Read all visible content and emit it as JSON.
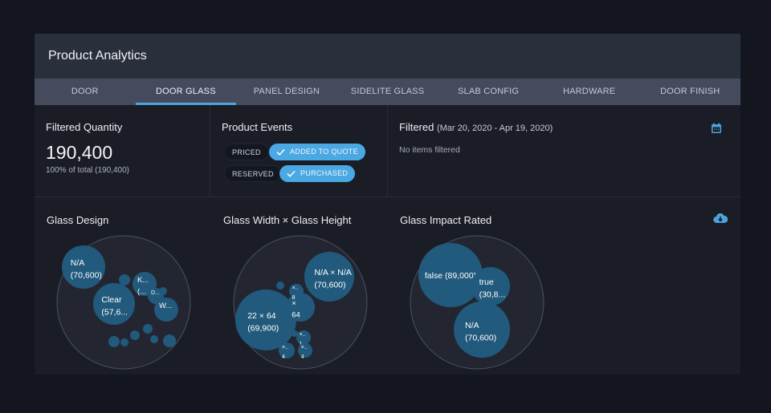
{
  "header": {
    "title": "Product Analytics"
  },
  "tabs": [
    {
      "label": "DOOR",
      "active": false
    },
    {
      "label": "DOOR GLASS",
      "active": true
    },
    {
      "label": "PANEL DESIGN",
      "active": false
    },
    {
      "label": "SIDELITE GLASS",
      "active": false
    },
    {
      "label": "SLAB CONFIG",
      "active": false
    },
    {
      "label": "HARDWARE",
      "active": false
    },
    {
      "label": "DOOR FINISH",
      "active": false
    }
  ],
  "filtered_quantity": {
    "title": "Filtered Quantity",
    "value": "190,400",
    "subtitle": "100% of total (190,400)"
  },
  "product_events": {
    "title": "Product Events",
    "pills": [
      {
        "label": "PRICED",
        "selected": false
      },
      {
        "label": "ADDED TO QUOTE",
        "selected": true
      },
      {
        "label": "RESERVED",
        "selected": false
      },
      {
        "label": "PURCHASED",
        "selected": true
      }
    ]
  },
  "filtered": {
    "title": "Filtered",
    "date_range": "(Mar 20, 2020 - Apr 19, 2020)",
    "empty_text": "No items filtered",
    "icon": "calendar-icon"
  },
  "download_icon": "cloud-download-icon",
  "colors": {
    "accent": "#4da3dc",
    "bubble": "#215a7c",
    "pill_selected": "#4aa8e3"
  },
  "chart_data": [
    {
      "type": "bubble",
      "title": "Glass Design",
      "bubbles": [
        {
          "label": "N/A",
          "value_label": "(70,600)"
        },
        {
          "label": "Clear",
          "value_label": "(57,6..."
        },
        {
          "label": "K...",
          "value_label": "(..."
        },
        {
          "label": "W...",
          "value_label": ""
        },
        {
          "label": "D...",
          "value_label": ""
        },
        {
          "label": "",
          "value_label": ""
        },
        {
          "label": "",
          "value_label": ""
        },
        {
          "label": "",
          "value_label": ""
        },
        {
          "label": "",
          "value_label": ""
        },
        {
          "label": "",
          "value_label": ""
        },
        {
          "label": "",
          "value_label": ""
        },
        {
          "label": "",
          "value_label": ""
        },
        {
          "label": "",
          "value_label": ""
        }
      ]
    },
    {
      "type": "bubble",
      "title": "Glass Width × Glass Height",
      "bubbles": [
        {
          "label": "N/A × N/A",
          "value_label": "(70,600)"
        },
        {
          "label": "22 × 64",
          "value_label": "(69,900)"
        },
        {
          "label": "×",
          "value_label": "64"
        },
        {
          "label": "×..",
          "value_label": "8"
        },
        {
          "label": "×..",
          "value_label": "1"
        },
        {
          "label": "×..",
          "value_label": "4"
        },
        {
          "label": "×..",
          "value_label": "4"
        },
        {
          "label": "",
          "value_label": ""
        },
        {
          "label": "",
          "value_label": ""
        },
        {
          "label": "",
          "value_label": ""
        }
      ]
    },
    {
      "type": "bubble",
      "title": "Glass Impact Rated",
      "bubbles": [
        {
          "label": "false",
          "value_label": "(89,000)"
        },
        {
          "label": "true",
          "value_label": "(30,8..."
        },
        {
          "label": "N/A",
          "value_label": "(70,600)"
        }
      ]
    }
  ]
}
